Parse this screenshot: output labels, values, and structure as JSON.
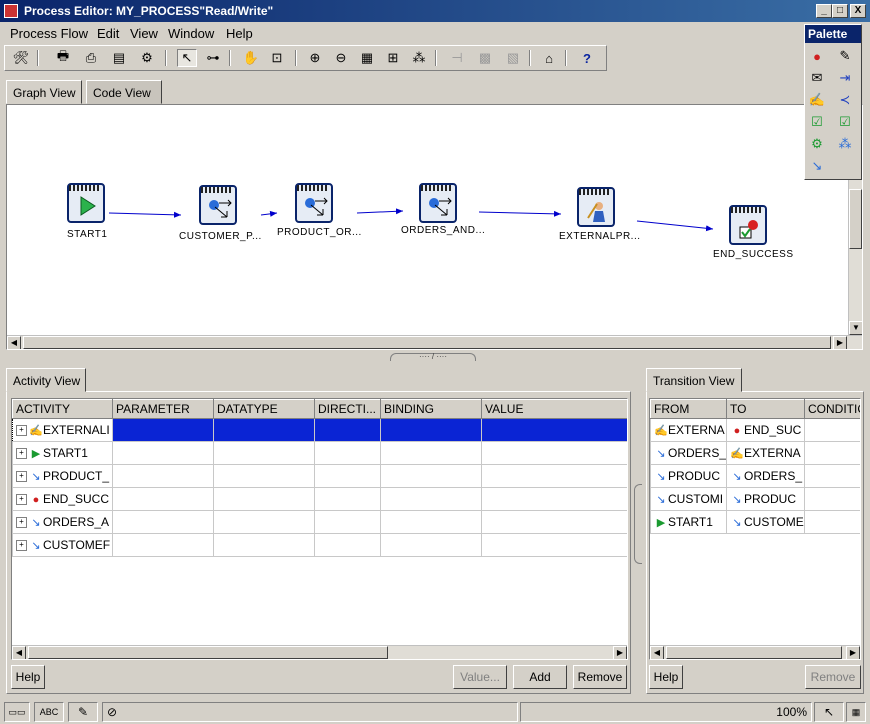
{
  "window": {
    "title": "Process Editor: MY_PROCESS\"Read/Write\"",
    "controls": [
      "_",
      "□",
      "X"
    ]
  },
  "menu": [
    "Process Flow",
    "Edit",
    "View",
    "Window",
    "Help"
  ],
  "palette": {
    "title": "Palette"
  },
  "graph_tabs": [
    "Graph View",
    "Code View"
  ],
  "nodes": [
    {
      "label": "START1"
    },
    {
      "label": "CUSTOMER_P..."
    },
    {
      "label": "PRODUCT_OR..."
    },
    {
      "label": "ORDERS_AND..."
    },
    {
      "label": "EXTERNALPR..."
    },
    {
      "label": "END_SUCCESS"
    }
  ],
  "activity_view": {
    "tab": "Activity View",
    "columns": [
      "ACTIVITY",
      "PARAMETER",
      "DATATYPE",
      "DIRECTI...",
      "BINDING",
      "VALUE"
    ],
    "rows": [
      {
        "name": "EXTERNALI",
        "icon": "external-process-icon"
      },
      {
        "name": "START1",
        "icon": "start-icon"
      },
      {
        "name": "PRODUCT_",
        "icon": "transform-icon"
      },
      {
        "name": "END_SUCC",
        "icon": "end-icon"
      },
      {
        "name": "ORDERS_A",
        "icon": "transform-icon"
      },
      {
        "name": "CUSTOMEF",
        "icon": "transform-icon"
      }
    ],
    "buttons": {
      "help": "Help",
      "value": "Value...",
      "add": "Add",
      "remove": "Remove"
    }
  },
  "transition_view": {
    "tab": "Transition View",
    "columns": [
      "FROM",
      "TO",
      "CONDITIC"
    ],
    "rows": [
      {
        "from": "EXTERNA",
        "to": "END_SUC"
      },
      {
        "from": "ORDERS_",
        "to": "EXTERNA"
      },
      {
        "from": "PRODUC",
        "to": "ORDERS_"
      },
      {
        "from": "CUSTOMI",
        "to": "PRODUC"
      },
      {
        "from": "START1",
        "to": "CUSTOME"
      }
    ],
    "buttons": {
      "help": "Help",
      "remove": "Remove"
    }
  },
  "status": {
    "zoom": "100%"
  }
}
